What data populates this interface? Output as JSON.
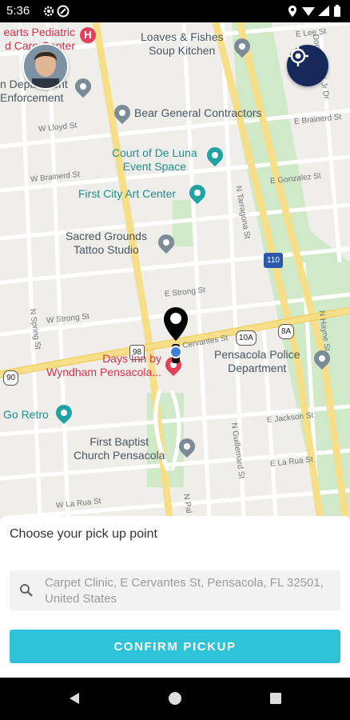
{
  "status_bar": {
    "time": "5:36"
  },
  "map": {
    "pois": [
      {
        "label": "earts Pediatric\nd Care Center"
      },
      {
        "label": "Loaves & Fishes\nSoup Kitchen"
      },
      {
        "label": "n Department\nEnforcement"
      },
      {
        "label": "Bear General Contractors"
      },
      {
        "label": "Court of De Luna\nEvent Space"
      },
      {
        "label": "First City Art Center"
      },
      {
        "label": "Sacred Grounds\nTattoo Studio"
      },
      {
        "label": "Days Inn by\nWyndham Pensacola..."
      },
      {
        "label": "Pensacola Police\nDepartment"
      },
      {
        "label": "Go Retro"
      },
      {
        "label": "First Baptist\nChurch Pensacola"
      }
    ],
    "streets": [
      {
        "label": "W Lloyd St"
      },
      {
        "label": "E Lee St"
      },
      {
        "label": "Doctor M L K Jr Dr"
      },
      {
        "label": "E Brainerd St"
      },
      {
        "label": "W Brainerd St"
      },
      {
        "label": "E Gonzalez St"
      },
      {
        "label": "N Tarragona St"
      },
      {
        "label": "E Strong St"
      },
      {
        "label": "W Strong St"
      },
      {
        "label": "N Spring St"
      },
      {
        "label": "Cervantes St"
      },
      {
        "label": "N Hayne St"
      },
      {
        "label": "N Guillemard St"
      },
      {
        "label": "E Jackson St"
      },
      {
        "label": "E La Rua St"
      },
      {
        "label": "W La Rua St"
      },
      {
        "label": "N Pal"
      }
    ],
    "shields": [
      {
        "label": "110"
      },
      {
        "label": "98"
      },
      {
        "label": "10A"
      },
      {
        "label": "8A"
      },
      {
        "label": "90"
      }
    ]
  },
  "sheet": {
    "title": "Choose your pick up point",
    "search_value": "Carpet Clinic, E Cervantes St, Pensacola, FL 32501, United States",
    "confirm_label": "CONFIRM PICKUP"
  }
}
